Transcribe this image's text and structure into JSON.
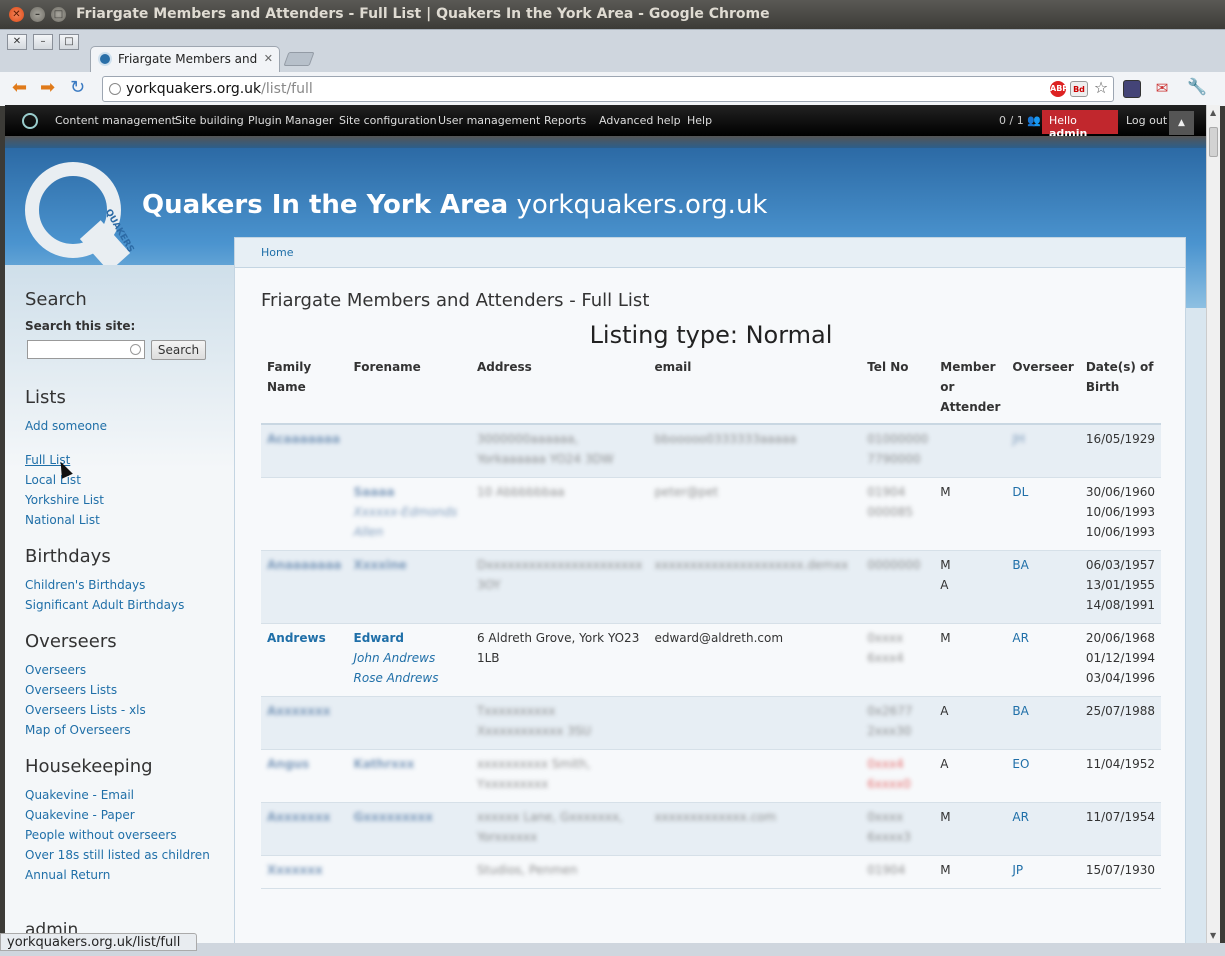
{
  "window": {
    "title": "Friargate Members and Attenders - Full List | Quakers In the York Area - Google Chrome"
  },
  "browser": {
    "tab_title": "Friargate Members and At",
    "url_host": "yorkquakers.org.uk",
    "url_path": "/list/full",
    "status_url": "yorkquakers.org.uk/list/full"
  },
  "admin_menu": {
    "items": [
      "Content management",
      "Site building",
      "Plugin Manager",
      "Site configuration",
      "User management",
      "Reports",
      "Advanced help",
      "Help"
    ],
    "users": "0 / 1",
    "hello": "Hello",
    "user": "admin",
    "logout": "Log out"
  },
  "header": {
    "site_name": "Quakers In the York Area",
    "slogan": "yorkquakers.org.uk",
    "logo_word": "QUAKERS"
  },
  "breadcrumb": "Home",
  "sidebar": {
    "search_title": "Search",
    "search_label": "Search this site:",
    "search_value": "",
    "search_button": "Search",
    "lists_title": "Lists",
    "lists_add": "Add someone",
    "lists": [
      "Full List",
      "Local List",
      "Yorkshire List",
      "National List"
    ],
    "birthdays_title": "Birthdays",
    "birthdays": [
      "Children's Birthdays",
      "Significant Adult Birthdays"
    ],
    "overseers_title": "Overseers",
    "overseers": [
      "Overseers",
      "Overseers Lists",
      "Overseers Lists - xls",
      "Map of Overseers"
    ],
    "housekeeping_title": "Housekeeping",
    "housekeeping": [
      "Quakevine - Email",
      "Quakevine - Paper",
      "People without overseers",
      "Over 18s still listed as children",
      "Annual Return"
    ],
    "admin_title": "admin"
  },
  "main": {
    "title": "Friargate Members and Attenders - Full List",
    "listing_type": "Listing type: Normal",
    "columns": [
      "Family Name",
      "Forename",
      "Address",
      "email",
      "Tel No",
      "Member or Attender",
      "Overseer",
      "Date(s) of Birth"
    ]
  },
  "rows": [
    {
      "family": "Acaaaaaaa",
      "forename": "",
      "children": [],
      "address": "3000000aaaaaa, Yorkaaaaaa YO24 3DW",
      "email": "bbooooo0333333aaaaa",
      "tel": "01000000 7790000",
      "ma": [
        ""
      ],
      "overseer": "JH",
      "dob": [
        "16/05/1929"
      ]
    },
    {
      "family": "",
      "forename": "Saaaa",
      "children": [
        "Xxxxxx-Edmonds Allen"
      ],
      "address": "10 Abbbbbbaa",
      "email": "peter@pet",
      "tel": "01904 000085",
      "ma": [
        "M"
      ],
      "overseer": "DL",
      "dob": [
        "30/06/1960",
        "10/06/1993",
        "10/06/1993"
      ]
    },
    {
      "family": "Anaaaaaaa",
      "forename": "Xxxxine",
      "children": [],
      "address": "Dxxxxxxxxxxxxxxxxxxxxxx 3OY",
      "email": "xxxxxxxxxxxxxxxxxxxxx.demxx",
      "tel": "0000000",
      "ma": [
        "M",
        "A"
      ],
      "overseer": "BA",
      "dob": [
        "06/03/1957",
        "13/01/1955",
        "14/08/1991"
      ]
    },
    {
      "family": "Andrews",
      "forename": "Edward",
      "children": [
        "John Andrews",
        "Rose Andrews"
      ],
      "address": "6 Aldreth Grove, York YO23 1LB",
      "email": "edward@aldreth.com",
      "tel": "0xxxx 6xxx4",
      "ma": [
        "M"
      ],
      "overseer": "AR",
      "dob": [
        "20/06/1968",
        "01/12/1994",
        "03/04/1996"
      ]
    },
    {
      "family": "Axxxxxxx",
      "forename": "",
      "children": [],
      "address": "Txxxxxxxxxx Xxxxxxxxxxxx 3SU",
      "email": "",
      "tel": "0x2677 2xxx30",
      "ma": [
        "A"
      ],
      "overseer": "BA",
      "dob": [
        "25/07/1988"
      ]
    },
    {
      "family": "Angus",
      "forename": "Kathrxxx",
      "children": [],
      "address": "xxxxxxxxxx Smith, Yxxxxxxxxx",
      "email": "",
      "tel": "0xxx4 6xxxx0",
      "ma": [
        "A"
      ],
      "overseer": "EO",
      "dob": [
        "11/04/1952"
      ]
    },
    {
      "family": "Axxxxxxx",
      "forename": "Gxxxxxxxxx",
      "children": [],
      "address": "xxxxxx Lane, Gxxxxxxx, Yorxxxxxx",
      "email": "xxxxxxxxxxxxx.com",
      "tel": "0xxxx 6xxxx3",
      "ma": [
        "M"
      ],
      "overseer": "AR",
      "dob": [
        "11/07/1954"
      ]
    },
    {
      "family": "Xxxxxxx",
      "forename": "",
      "children": [],
      "address": "Studios, Penmen",
      "email": "",
      "tel": "01904",
      "ma": [
        "M"
      ],
      "overseer": "JP",
      "dob": [
        "15/07/1930"
      ]
    }
  ]
}
